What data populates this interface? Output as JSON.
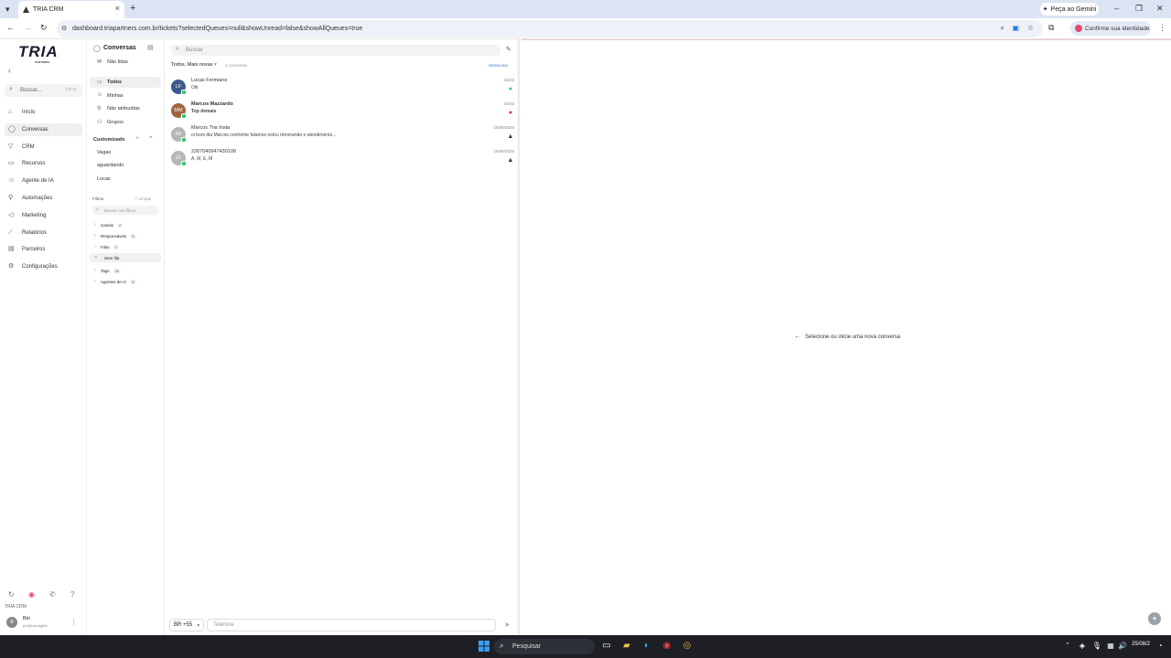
{
  "browser": {
    "tab_title": "TRIA CRM",
    "url": "dashboard.triapartners.com.br/tickets?selectedQueues=null&showUnread=false&showAllQueues=true",
    "gemini_label": "Peça ao Gemini",
    "identity_label": "Confirme sua identidade"
  },
  "app": {
    "logo": "TRIA",
    "logo_sub": "PARTNERS",
    "search_placeholder": "Buscar...",
    "search_shortcut": "Ctrl+K",
    "nav": [
      {
        "label": "Início",
        "icon": "home-icon"
      },
      {
        "label": "Conversas",
        "icon": "chat-icon",
        "active": true
      },
      {
        "label": "CRM",
        "icon": "filter-icon"
      },
      {
        "label": "Recursos",
        "icon": "folder-icon"
      },
      {
        "label": "Agente de IA",
        "icon": "bot-icon"
      },
      {
        "label": "Automações",
        "icon": "automation-icon"
      },
      {
        "label": "Marketing",
        "icon": "megaphone-icon"
      },
      {
        "label": "Relatórios",
        "icon": "chart-icon"
      },
      {
        "label": "Parceiros",
        "icon": "partners-icon"
      },
      {
        "label": "Configurações",
        "icon": "gear-icon"
      }
    ],
    "footer_brand": "TRIA CRM",
    "user": {
      "initial": "B",
      "name": "Biri",
      "email": "biri@tria.digital"
    }
  },
  "folders": {
    "title": "Conversas",
    "unread": "Não lidas",
    "items": [
      {
        "label": "Todos",
        "active": true
      },
      {
        "label": "Minhas"
      },
      {
        "label": "Não atribuídas"
      },
      {
        "label": "Grupos"
      }
    ],
    "custom_title": "Customizado",
    "custom_items": [
      "Vagas",
      "aguardando",
      "Lucas"
    ],
    "filters_title": "Filtros",
    "clear_label": "Limpar",
    "filter_search_placeholder": "Buscar nos filtros",
    "filter_groups": [
      {
        "label": "Canais",
        "count": "2"
      },
      {
        "label": "Responsáveis",
        "count": "5"
      },
      {
        "label": "Filas",
        "count": "2"
      },
      {
        "label": "Sem fila",
        "sub": true
      },
      {
        "label": "Tags",
        "count": "26"
      },
      {
        "label": "Agentes de IA",
        "count": "8"
      }
    ]
  },
  "list": {
    "search_placeholder": "Buscar",
    "sort_label": "Todos, Mais novas",
    "count_label": "4 conversas",
    "select_label": "Selecionar",
    "conversations": [
      {
        "name": "Lucas Fermiano",
        "message": "Oiii",
        "time": "15/02",
        "initials": "LF",
        "avatar_color": "#3d5a8c",
        "channel": "whatsapp-icon"
      },
      {
        "name": "Marcos Mazzardo",
        "message": "Top demais",
        "time": "16/02",
        "initials": "MM",
        "avatar_color": "#a0653f",
        "channel": "instagram-icon",
        "bold": true
      },
      {
        "name": "Marcos Tria Insta",
        "message": "oi bom dia Marcos conforme falamos estou retornando o atendimento...",
        "time": "16/08/2026",
        "initials": "MI",
        "avatar_color": "#b7b7b7",
        "channel": "tria-icon"
      },
      {
        "name": "2267040947430109",
        "message": "A, M, E, M",
        "time": "16/08/2026",
        "initials": "22",
        "avatar_color": "#b7b7b7",
        "channel": "tria-icon"
      }
    ],
    "country_code": "BR +55",
    "phone_placeholder": "Telefone"
  },
  "main": {
    "empty_label": "Selecione ou inicie uma nova conversa"
  },
  "taskbar": {
    "search_label": "Pesquisar",
    "date": "25/08/2"
  }
}
